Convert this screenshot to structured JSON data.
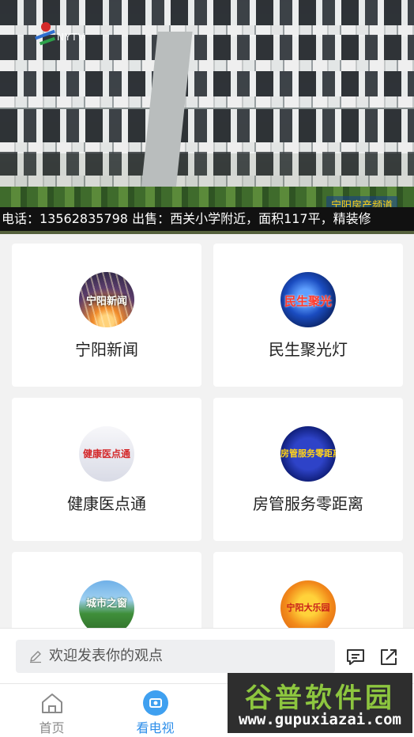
{
  "video": {
    "logo_text": "NYTV",
    "station_tag": "宁阳房产频道",
    "ticker": "电话：13562835798   出售：西关小学附近，面积117平，精装修"
  },
  "channels": [
    {
      "name": "宁阳新闻",
      "thumb_text": "宁阳新闻",
      "icon": "ningyang-news-thumbnail"
    },
    {
      "name": "民生聚光灯",
      "thumb_text": "民生聚光",
      "icon": "minsheng-spotlight-thumbnail"
    },
    {
      "name": "健康医点通",
      "thumb_text": "健康医点通",
      "icon": "health-thumbnail"
    },
    {
      "name": "房管服务零距离",
      "thumb_text": "房管服务零距离",
      "icon": "housing-service-thumbnail"
    },
    {
      "name": "",
      "thumb_text": "城市之窗",
      "icon": "city-window-thumbnail"
    },
    {
      "name": "",
      "thumb_text": "宁阳大乐园",
      "icon": "farm-thumbnail"
    }
  ],
  "comment": {
    "placeholder": "欢迎发表你的观点",
    "pencil_icon": "pencil-icon",
    "comment_icon": "comment-icon",
    "share_icon": "share-icon"
  },
  "tabs": [
    {
      "label": "首页",
      "icon": "home-icon",
      "active": false
    },
    {
      "label": "看电视",
      "icon": "tv-icon",
      "active": true
    }
  ],
  "watermark": {
    "title": "谷普软件园",
    "url": "www.gupuxiazai.com"
  }
}
